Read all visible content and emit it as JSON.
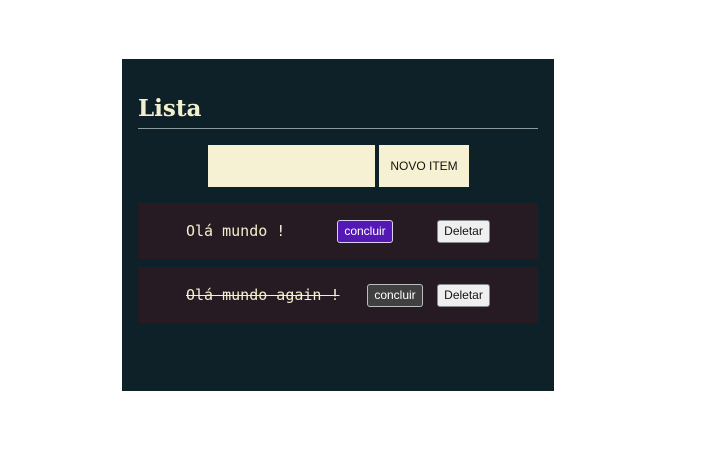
{
  "header": {
    "title": "Lista"
  },
  "new_item": {
    "input_value": "",
    "button_label": "NOVO ITEM"
  },
  "items": [
    {
      "text": "Olá mundo !",
      "done": false,
      "conclude_label": "concluir",
      "delete_label": "Deletar"
    },
    {
      "text": "Olá mundo again !",
      "done": true,
      "conclude_label": "concluir",
      "delete_label": "Deletar"
    }
  ],
  "colors": {
    "panel_background": "#0e2128",
    "item_background": "#261b22",
    "text_cream": "#f4efcf",
    "input_background": "#f6f1d2",
    "conclude_active": "#5318b5",
    "conclude_muted": "#404040"
  }
}
